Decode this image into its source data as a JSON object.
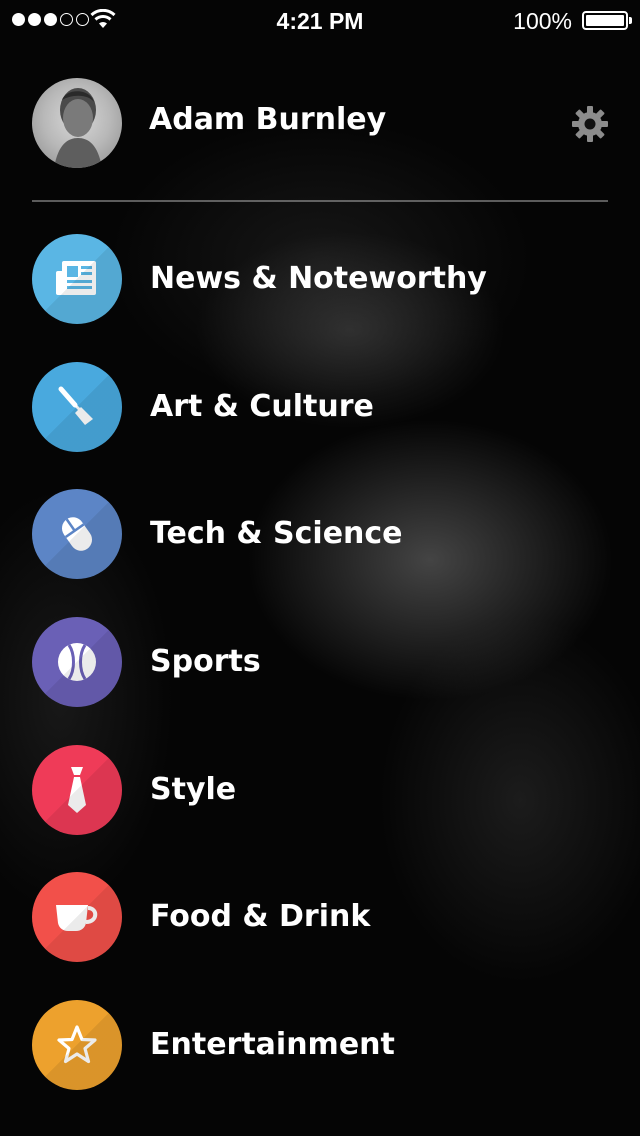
{
  "status_bar": {
    "time": "4:21 PM",
    "battery_percent": "100%",
    "signal_bars": 3,
    "signal_total": 5
  },
  "profile": {
    "name": "Adam Burnley",
    "settings_icon": "gear-icon"
  },
  "menu": {
    "items": [
      {
        "label": "News & Noteworthy",
        "icon": "newspaper-icon",
        "color": "#5AB6E4"
      },
      {
        "label": "Art & Culture",
        "icon": "paintbrush-icon",
        "color": "#49A9DE"
      },
      {
        "label": "Tech & Science",
        "icon": "mouse-icon",
        "color": "#5C85C6"
      },
      {
        "label": "Sports",
        "icon": "baseball-icon",
        "color": "#6A60B6"
      },
      {
        "label": "Style",
        "icon": "necktie-icon",
        "color": "#EF3B58"
      },
      {
        "label": "Food & Drink",
        "icon": "cup-icon",
        "color": "#F2504A"
      },
      {
        "label": "Entertainment",
        "icon": "star-icon",
        "color": "#EDA12D"
      }
    ]
  }
}
